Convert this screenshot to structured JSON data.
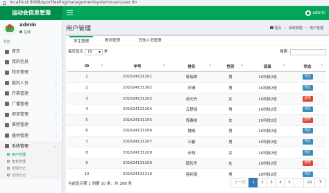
{
  "browser": {
    "url": "localhost:8088/sportfeelingmanagementsystem/user/user.do"
  },
  "header": {
    "logo": "运动会信息管理",
    "user_name": "admin"
  },
  "sidebar": {
    "user": {
      "name": "admin",
      "status": "在线"
    },
    "nav_header": "导航",
    "items": [
      {
        "label": "首页",
        "icon": "home-icon",
        "has_children": false
      },
      {
        "label": "我的信息",
        "icon": "user-icon",
        "has_children": true
      },
      {
        "label": "院系管理",
        "icon": "building-icon",
        "has_children": true
      },
      {
        "label": "裁判人员",
        "icon": "users-icon",
        "has_children": true
      },
      {
        "label": "开幕管理",
        "icon": "flag-icon",
        "has_children": true
      },
      {
        "label": "广播管理",
        "icon": "broadcast-icon",
        "has_children": true
      },
      {
        "label": "项目管理",
        "icon": "list-icon",
        "has_children": true
      },
      {
        "label": "赛程管理",
        "icon": "calendar-icon",
        "has_children": true
      },
      {
        "label": "器材管理",
        "icon": "box-icon",
        "has_children": true
      },
      {
        "label": "系统管理",
        "icon": "gear-icon",
        "has_children": true,
        "open": true
      }
    ],
    "submenu": [
      {
        "label": "用户管理",
        "active": true
      },
      {
        "label": "角色管理",
        "active": false
      },
      {
        "label": "反馈日记",
        "active": false
      },
      {
        "label": "访问日记",
        "active": false
      }
    ]
  },
  "content": {
    "title": "用户管理",
    "breadcrumb": [
      "首页",
      "系统管理",
      "用户管理"
    ]
  },
  "tabs": [
    {
      "label": "学生管理",
      "active": true
    },
    {
      "label": "教师管理",
      "active": false
    },
    {
      "label": "其他人员管理",
      "active": false
    }
  ],
  "table_controls": {
    "show_prefix": "每页显示",
    "page_size": "10",
    "show_suffix": "条",
    "search_label": "搜索:"
  },
  "table": {
    "columns": [
      "ID",
      "学号",
      "姓名",
      "性别",
      "班级",
      "状态"
    ],
    "rows": [
      {
        "id": "1",
        "sno": "201624131201",
        "name": "蒋瑞翠",
        "gender": "男",
        "class": "16科技2班",
        "status": "开启"
      },
      {
        "id": "2",
        "sno": "201624131202",
        "name": "邓琳",
        "gender": "男",
        "class": "16科技2班",
        "status": "开启"
      },
      {
        "id": "3",
        "sno": "201624131203",
        "name": "叔元先",
        "gender": "女",
        "class": "16科技2班",
        "status": "禁用"
      },
      {
        "id": "4",
        "sno": "201624131204",
        "name": "丘楚靖",
        "gender": "男",
        "class": "16科技2班",
        "status": "开启"
      },
      {
        "id": "5",
        "sno": "201624131205",
        "name": "胥春桃",
        "gender": "女",
        "class": "16科技2班",
        "status": "禁用"
      },
      {
        "id": "6",
        "sno": "201624131206",
        "name": "魏梅",
        "gender": "男",
        "class": "16科技2班",
        "status": "开启"
      },
      {
        "id": "7",
        "sno": "201624131207",
        "name": "公春",
        "gender": "男",
        "class": "16科技2班",
        "status": "开启"
      },
      {
        "id": "8",
        "sno": "201624131208",
        "name": "步翔",
        "gender": "女",
        "class": "16科技2班",
        "status": "开启"
      },
      {
        "id": "9",
        "sno": "201624131209",
        "name": "毅彤舟",
        "gender": "女",
        "class": "16科技2班",
        "status": "禁用"
      },
      {
        "id": "10",
        "sno": "201624131210",
        "name": "容初晴",
        "gender": "男",
        "class": "16科技2班",
        "status": "开启"
      }
    ]
  },
  "status_colors": {
    "开启": "#3c8dbc",
    "禁用": "#dd4b39"
  },
  "pagination": {
    "info": "当前显示第 1 到第 10 条，共 288 条",
    "prev": "上一页",
    "pages": [
      "1",
      "2",
      "3",
      "4",
      "5",
      "…",
      "29"
    ],
    "active_page": "1",
    "next": "下"
  }
}
